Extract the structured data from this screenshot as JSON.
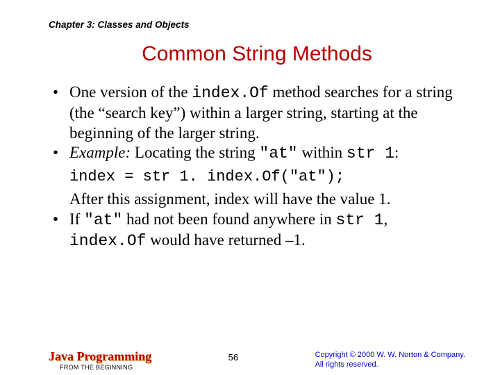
{
  "chapter": "Chapter 3: Classes and Objects",
  "title": "Common String Methods",
  "bullet1": {
    "pre": "One version of the ",
    "code": "index.Of",
    "post": " method searches for a string (the “search key”) within a larger string, starting at the beginning of the larger string."
  },
  "bullet2": {
    "label": "Example:",
    "pre": " Locating the string ",
    "q1": "\"at\"",
    "mid": " within ",
    "s1": "str 1",
    "end": ":"
  },
  "code_line": "index = str 1. index.Of(\"at\");",
  "after_code": "After this assignment, index will have the value 1.",
  "bullet3": {
    "pre": "If ",
    "q1": "\"at\"",
    "mid1": " had not been found anywhere in ",
    "s1": "str 1",
    "mid2": ", ",
    "code": "index.Of",
    "post": " would have returned –1."
  },
  "footer": {
    "brand_top": "Java Programming",
    "brand_bottom": "FROM THE BEGINNING",
    "page": "56",
    "copyright_l1": "Copyright © 2000 W. W. Norton & Company.",
    "copyright_l2": "All rights reserved."
  }
}
